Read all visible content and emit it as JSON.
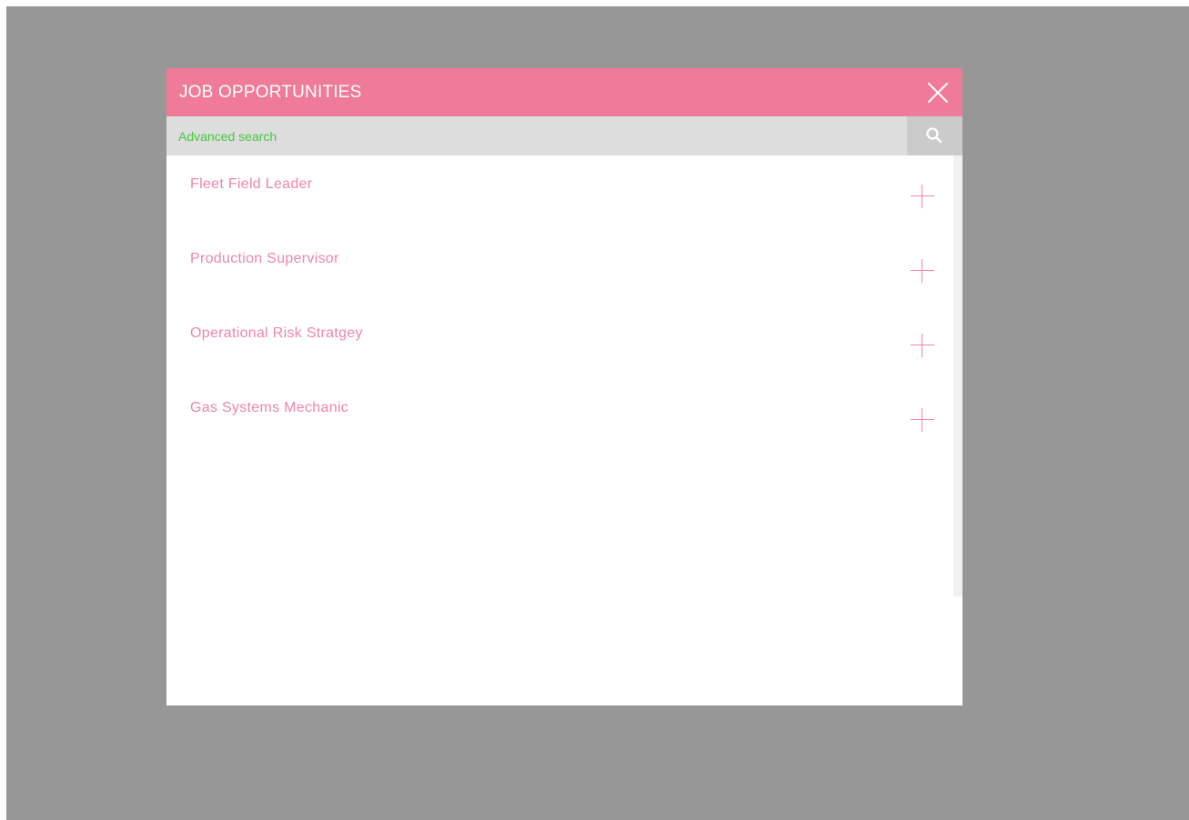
{
  "modal": {
    "title": "JOB OPPORTUNITIES",
    "close_icon": "close-icon"
  },
  "search": {
    "advanced_label": "Advanced search",
    "icon": "search-icon"
  },
  "jobs": [
    {
      "title": "Fleet Field Leader",
      "action_icon": "plus-icon"
    },
    {
      "title": "Production Supervisor",
      "action_icon": "plus-icon"
    },
    {
      "title": "Operational Risk Stratgey",
      "action_icon": "plus-icon"
    },
    {
      "title": "Gas Systems Mechanic",
      "action_icon": "plus-icon"
    }
  ],
  "colors": {
    "header": "#ef7b98",
    "job_text": "#ee86a9",
    "advanced_search": "#48c640",
    "backdrop": "#979797",
    "search_bar": "#dddddd"
  }
}
